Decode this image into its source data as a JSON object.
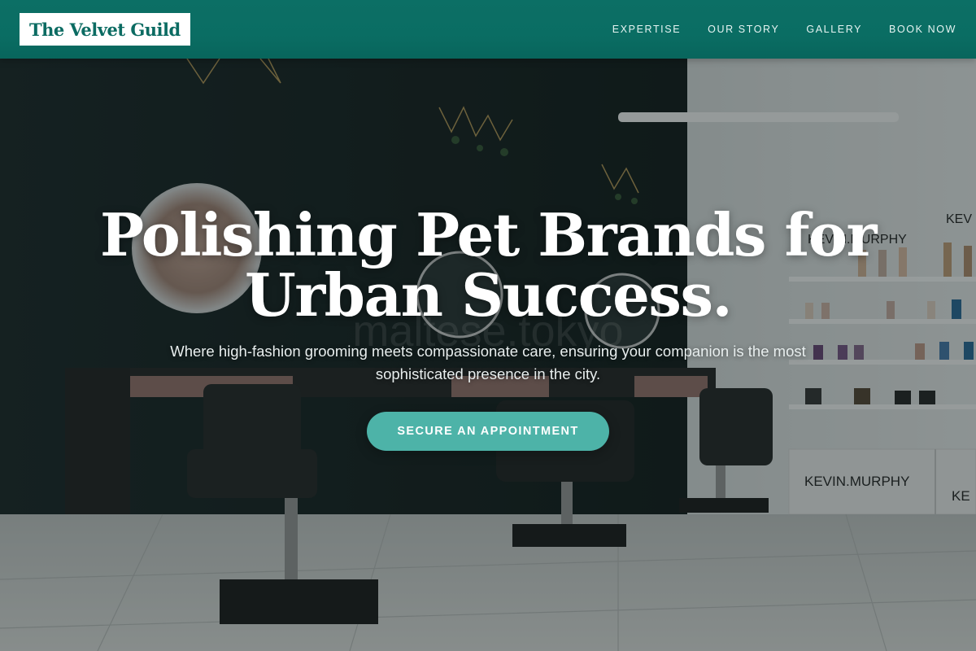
{
  "brand": {
    "name": "The Velvet Guild"
  },
  "nav": {
    "items": [
      {
        "label": "EXPERTISE"
      },
      {
        "label": "OUR STORY"
      },
      {
        "label": "GALLERY"
      },
      {
        "label": "BOOK NOW"
      }
    ]
  },
  "hero": {
    "title": "Polishing Pet Brands for Urban Success.",
    "subtitle": "Where high-fashion grooming meets compassionate care, ensuring your companion is the most sophisticated presence in the city.",
    "cta_label": "SECURE AN APPOINTMENT",
    "background": {
      "signage": [
        "KEVIN.MURPHY",
        "KEVIN.MURPHY",
        "KEV",
        "KE"
      ],
      "window_text": "maltese.tokyo"
    }
  },
  "colors": {
    "header": "#0a6d63",
    "accent": "#4db3a8",
    "logo_text": "#0b6b62"
  }
}
